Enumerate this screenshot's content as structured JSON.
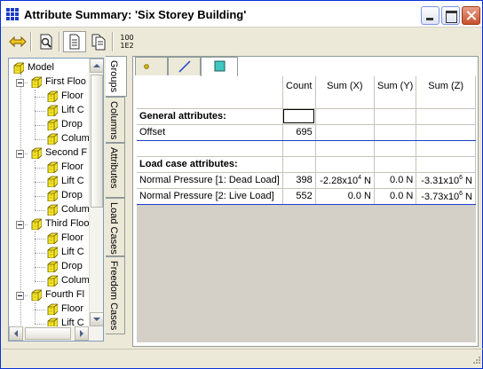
{
  "window": {
    "title": "Attribute Summary: 'Six Storey Building'"
  },
  "toolbar": {
    "buttons": [
      {
        "name": "swap-arrows-icon"
      },
      {
        "name": "preview-icon"
      },
      {
        "name": "document-icon"
      },
      {
        "name": "documents-icon"
      },
      {
        "name": "number-format-icon",
        "line1": "100",
        "line2": "1E2"
      }
    ]
  },
  "tree": {
    "root": "Model",
    "groups": [
      {
        "label": "First Floo",
        "children": [
          "Floor",
          "Lift C",
          "Drop",
          "Colum"
        ]
      },
      {
        "label": "Second F",
        "children": [
          "Floor",
          "Lift C",
          "Drop",
          "Colum"
        ]
      },
      {
        "label": "Third Floo",
        "children": [
          "Floor",
          "Lift C",
          "Drop",
          "Colum"
        ]
      },
      {
        "label": "Fourth Fl",
        "children": [
          "Floor",
          "Lift C"
        ]
      }
    ]
  },
  "side_tabs": [
    "Groups",
    "Columns",
    "Attributes",
    "Load Cases",
    "Freedom Cases"
  ],
  "top_tabs": [
    "point-icon",
    "line-icon",
    "plate-icon"
  ],
  "grid": {
    "columns": [
      "Count",
      "Sum (X)",
      "Sum (Y)",
      "Sum (Z)"
    ],
    "general_heading": "General attributes:",
    "offset": {
      "label": "Offset",
      "count": "695"
    },
    "load_heading": "Load case attributes:",
    "rows": [
      {
        "label": "Normal Pressure [1: Dead Load]",
        "count": "398",
        "sx_mant": "-2.28x10",
        "sx_exp": "4",
        "sx_unit": " N",
        "sy": "0.0 N",
        "sz_mant": "-3.31x10",
        "sz_exp": "6",
        "sz_unit": " N"
      },
      {
        "label": "Normal Pressure [2: Live Load]",
        "count": "552",
        "sx": "0.0 N",
        "sy": "0.0 N",
        "sz_mant": "-3.73x10",
        "sz_exp": "6",
        "sz_unit": " N"
      }
    ]
  },
  "colors": {
    "title_icon": "#1a3cc8",
    "cube_fill": "#f5e62a",
    "separator_blue": "#1c3fd0"
  }
}
